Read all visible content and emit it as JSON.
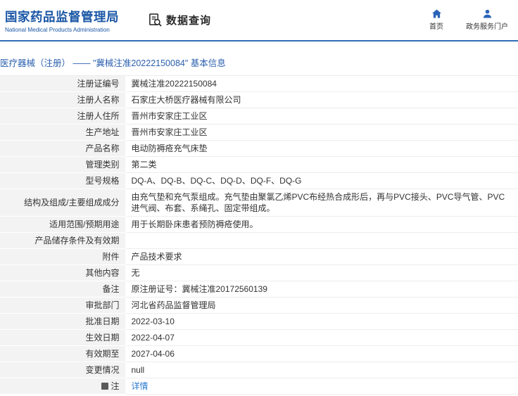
{
  "header": {
    "org_name_cn": "国家药品监督管理局",
    "org_name_en": "National Medical Products Administration",
    "section_title": "数据查询",
    "nav": [
      {
        "label": "首页",
        "icon": "home-icon"
      },
      {
        "label": "政务服务门户",
        "icon": "user-icon"
      }
    ]
  },
  "breadcrumb": {
    "text": "医疗器械（注册） —— \"冀械注准20222150084\" 基本信息"
  },
  "colors": {
    "brand_blue": "#1b57a6",
    "header_line_blue": "#2e6db4",
    "breadcrumb_blue": "#2a5fae",
    "link_blue": "#2a7ad2",
    "label_bg": "#f3f3f3"
  },
  "table": {
    "rows": [
      {
        "label": "注册证编号",
        "value": "冀械注准20222150084"
      },
      {
        "label": "注册人名称",
        "value": "石家庄大桥医疗器械有限公司"
      },
      {
        "label": "注册人住所",
        "value": "晋州市安家庄工业区"
      },
      {
        "label": "生产地址",
        "value": "晋州市安家庄工业区"
      },
      {
        "label": "产品名称",
        "value": "电动防褥疮充气床垫"
      },
      {
        "label": "管理类别",
        "value": "第二类"
      },
      {
        "label": "型号规格",
        "value": "DQ-A、DQ-B、DQ-C、DQ-D、DQ-F、DQ-G"
      },
      {
        "label": "结构及组成/主要组成成分",
        "value": "由充气垫和充气泵组成。充气垫由聚氯乙烯PVC布经热合成形后，再与PVC接头、PVC导气管、PVC进气阀、布套、系绳孔、固定带组成。"
      },
      {
        "label": "适用范围/预期用途",
        "value": "用于长期卧床患者预防褥疮使用。"
      },
      {
        "label": "产品储存条件及有效期",
        "value": ""
      },
      {
        "label": "附件",
        "value": "产品技术要求"
      },
      {
        "label": "其他内容",
        "value": "无"
      },
      {
        "label": "备注",
        "value": "原注册证号：冀械注准20172560139"
      },
      {
        "label": "审批部门",
        "value": "河北省药品监督管理局"
      },
      {
        "label": "批准日期",
        "value": "2022-03-10"
      },
      {
        "label": "生效日期",
        "value": "2022-04-07"
      },
      {
        "label": "有效期至",
        "value": "2027-04-06"
      },
      {
        "label": "变更情况",
        "value": "null"
      },
      {
        "label": "注",
        "value": "详情",
        "link": true,
        "icon": "note-icon"
      }
    ]
  }
}
